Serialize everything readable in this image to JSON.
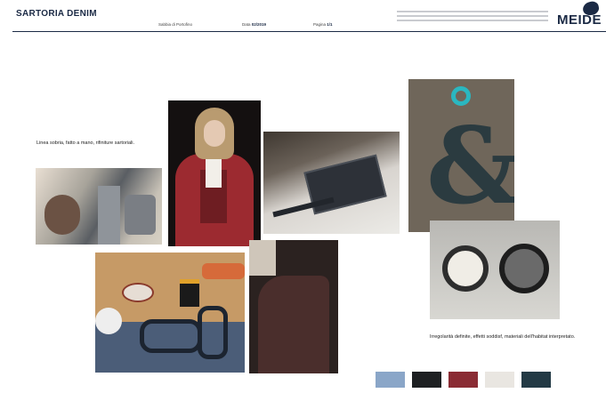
{
  "header": {
    "title": "SARTORIA DENIM",
    "meta_1_label": "Sabbia di Portofino",
    "meta_2_label": "Data",
    "meta_2_value": "02/2019",
    "meta_3_label": "Pagina",
    "meta_3_value": "1/1",
    "logo": "MEIDE"
  },
  "captions": {
    "left": "Linea sobria, fatto a mano, rifiniture sartoriali.",
    "right": "Irregolarità definite, effetti soddisf, materiali dell'habitat interpretato."
  },
  "images": [
    {
      "name": "craft-tools-photo"
    },
    {
      "name": "woman-red-suit-photo"
    },
    {
      "name": "pocket-detail-photo"
    },
    {
      "name": "ampersand-photo"
    },
    {
      "name": "sewing-desk-photo"
    },
    {
      "name": "leather-garment-photo"
    },
    {
      "name": "ceramic-bowls-photo"
    }
  ],
  "palette": [
    "#8aa6c8",
    "#1e2022",
    "#8a2b33",
    "#e9e6e1",
    "#233a45"
  ]
}
